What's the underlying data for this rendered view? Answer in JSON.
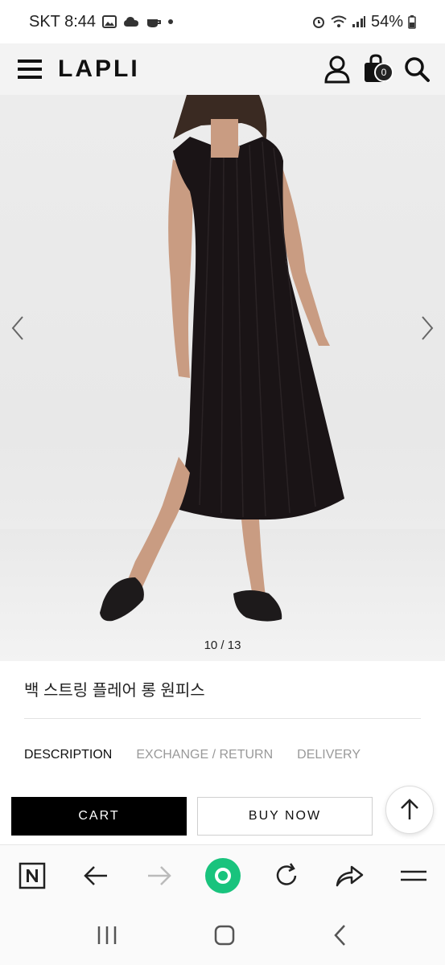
{
  "status_bar": {
    "carrier_time": "SKT 8:44",
    "battery": "54%"
  },
  "header": {
    "logo": "LAPLI",
    "cart_count": "0"
  },
  "gallery": {
    "counter": "10 / 13"
  },
  "product": {
    "title": "백 스트링 플레어 롱 원피스"
  },
  "tabs": [
    {
      "label": "DESCRIPTION",
      "active": true
    },
    {
      "label": "EXCHANGE / RETURN",
      "active": false
    },
    {
      "label": "DELIVERY",
      "active": false
    }
  ],
  "actions": {
    "cart_label": "CART",
    "buy_label": "BUY NOW"
  },
  "browser_toolbar": {
    "icons": [
      "naver-n-icon",
      "back-arrow-icon",
      "forward-arrow-icon",
      "home-circle-icon",
      "refresh-icon",
      "share-icon",
      "menu-icon"
    ]
  },
  "colors": {
    "accent_green": "#19c37d",
    "cart_bg": "#000000",
    "dress": "#1a1416"
  }
}
